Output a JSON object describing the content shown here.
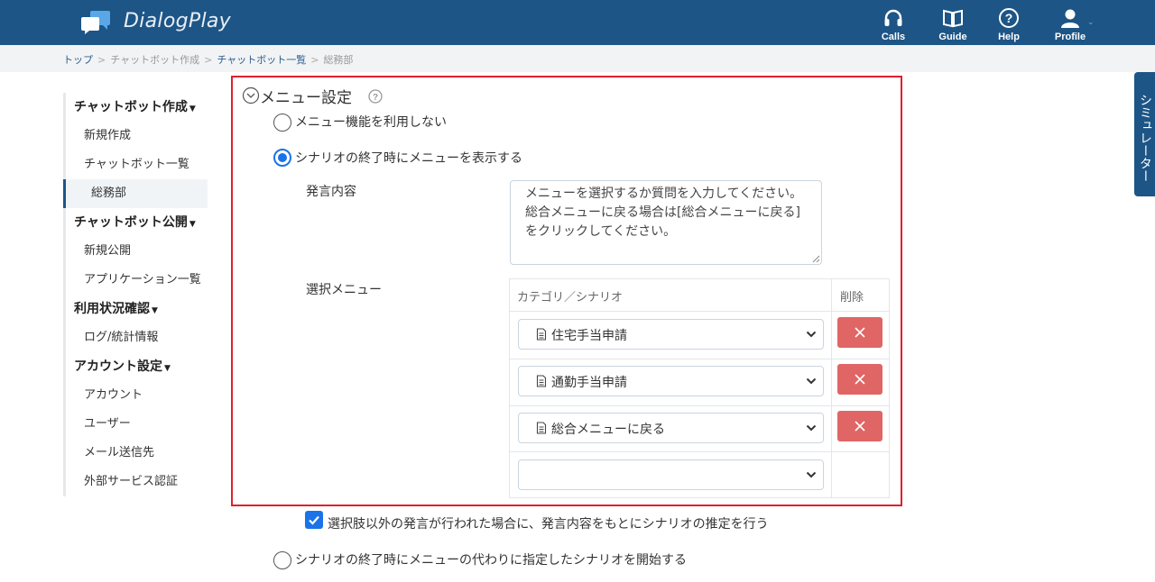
{
  "header": {
    "app_name": "DialogPlay",
    "nav": [
      {
        "label": "Calls",
        "icon": "headset-icon"
      },
      {
        "label": "Guide",
        "icon": "book-icon"
      },
      {
        "label": "Help",
        "icon": "help-circle-icon"
      },
      {
        "label": "Profile",
        "icon": "user-icon"
      }
    ]
  },
  "breadcrumb": [
    "トップ",
    "チャットボット作成",
    "チャットボット一覧",
    "総務部"
  ],
  "sidebar": {
    "groups": [
      {
        "title": "チャットボット作成",
        "items": [
          "新規作成",
          "チャットボット一覧",
          "総務部"
        ]
      },
      {
        "title": "チャットボット公開",
        "items": [
          "新規公開",
          "アプリケーション一覧"
        ]
      },
      {
        "title": "利用状況確認",
        "items": [
          "ログ/統計情報"
        ]
      },
      {
        "title": "アカウント設定",
        "items": [
          "アカウント",
          "ユーザー",
          "メール送信先",
          "外部サービス認証"
        ]
      }
    ]
  },
  "menu_settings": {
    "title": "メニュー設定",
    "option_none": "メニュー機能を利用しない",
    "option_show": "シナリオの終了時にメニューを表示する",
    "utterance_label": "発言内容",
    "utterance_text": "メニューを選択するか質問を入力してください。\n総合メニューに戻る場合は[総合メニューに戻る]をクリックしてください。",
    "select_menu_label": "選択メニュー",
    "table_header_category": "カテゴリ／シナリオ",
    "table_header_delete": "削除",
    "menu_rows": [
      "住宅手当申請",
      "通勤手当申請",
      "総合メニューに戻る",
      ""
    ],
    "estimate_checkbox": "選択肢以外の発言が行われた場合に、発言内容をもとにシナリオの推定を行う",
    "option_start_scenario": "シナリオの終了時にメニューの代わりに指定したシナリオを開始する"
  },
  "simulator_tab": "シミュレーター",
  "colors": {
    "header_bg": "#1d5586",
    "accent_blue": "#1a73e8",
    "highlight_red": "#e0202c",
    "delete_red": "#e06565"
  }
}
